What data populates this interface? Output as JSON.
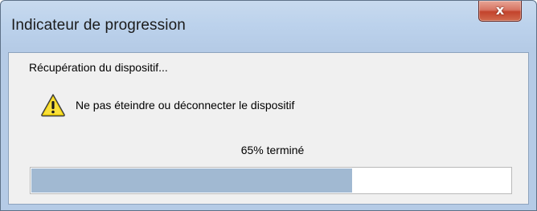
{
  "window": {
    "title": "Indicateur de progression",
    "close_label": "x"
  },
  "dialog": {
    "status": "Récupération du dispositif...",
    "warning_text": "Ne pas éteindre ou déconnecter le dispositif",
    "progress_text": "65% terminé",
    "progress_fraction": 0.67
  },
  "icons": {
    "warning": "warning-icon",
    "close": "close-icon"
  },
  "colors": {
    "progress_fill": "#a1b9d2",
    "warning_yellow": "#f5d60f",
    "close_red": "#c3432c"
  }
}
